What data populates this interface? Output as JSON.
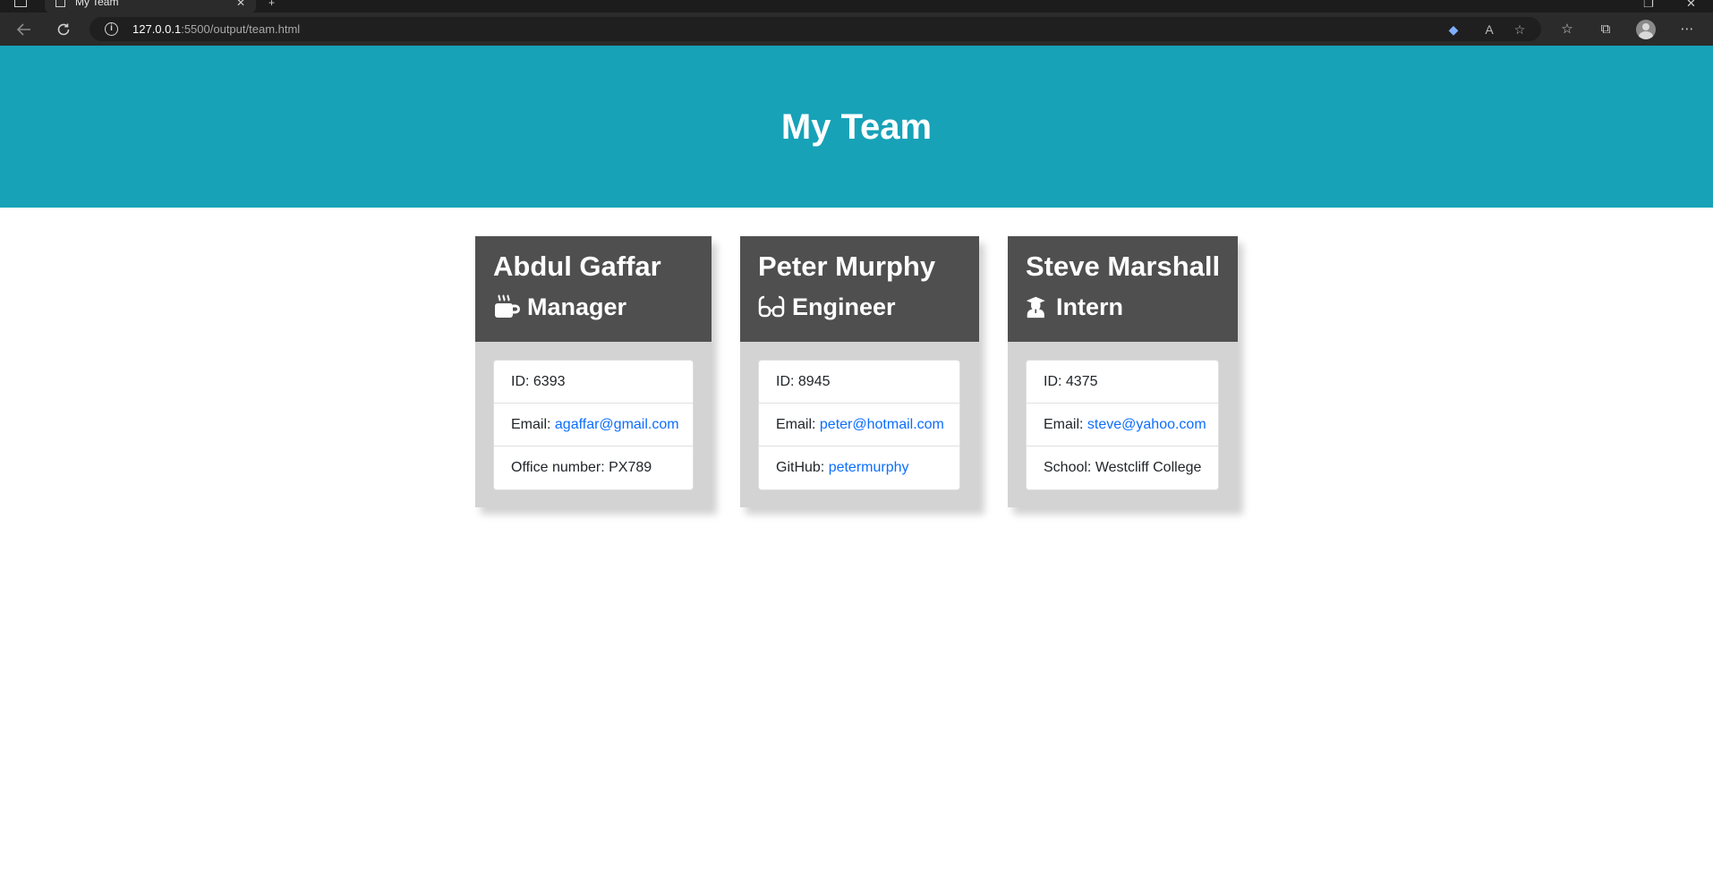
{
  "browser": {
    "tab_title": "My Team",
    "url_host": "127.0.0.1",
    "url_path": ":5500/output/team.html"
  },
  "page": {
    "heading": "My Team"
  },
  "cards": [
    {
      "name": "Abdul Gaffar",
      "role": "Manager",
      "role_icon": "mug-hot-icon",
      "id_label": "ID: ",
      "id": "6393",
      "email_label": "Email: ",
      "email": "agaffar@gmail.com",
      "extra_label": "Office number: ",
      "extra_value": "PX789"
    },
    {
      "name": "Peter Murphy",
      "role": "Engineer",
      "role_icon": "glasses-icon",
      "id_label": "ID: ",
      "id": "8945",
      "email_label": "Email: ",
      "email": "peter@hotmail.com",
      "extra_label": "GitHub: ",
      "extra_value": "petermurphy"
    },
    {
      "name": "Steve Marshall",
      "role": "Intern",
      "role_icon": "user-graduate-icon",
      "id_label": "ID: ",
      "id": "4375",
      "email_label": "Email: ",
      "email": "steve@yahoo.com",
      "extra_label": "School: ",
      "extra_value": "Westcliff College"
    }
  ],
  "colors": {
    "header_bg": "#17a2b8",
    "card_head_bg": "#4f4f4f",
    "card_body_bg": "#d3d3d3",
    "link": "#0d6efd"
  }
}
